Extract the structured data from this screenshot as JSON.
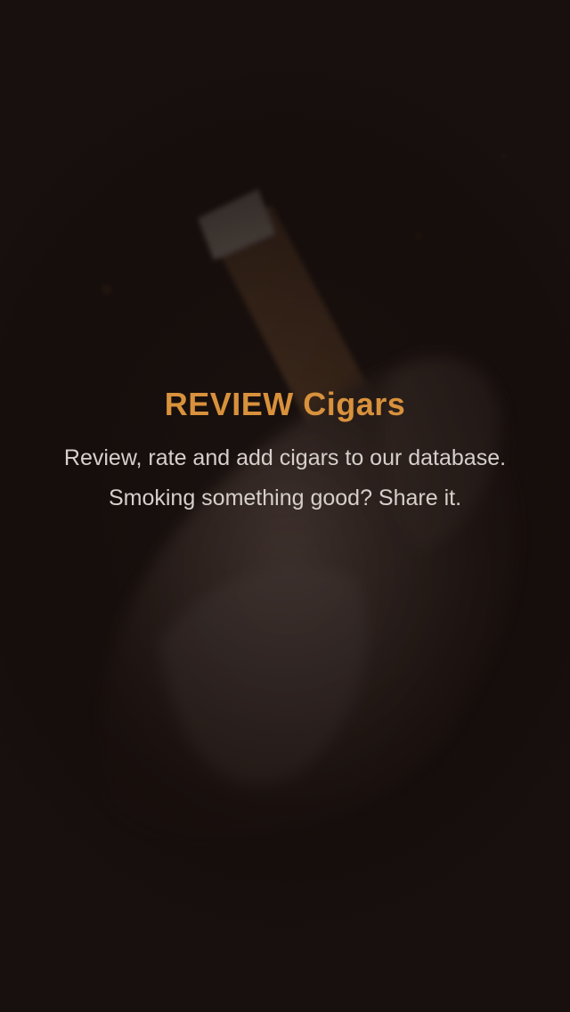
{
  "onboarding": {
    "title": "REVIEW Cigars",
    "description": "Review, rate and add cigars to our database. Smoking something good? Share it.",
    "background_image": "hand-holding-cigar-photo"
  },
  "colors": {
    "background": "#1a1210",
    "title": "#d8913c",
    "body_text": "#d6cfcb"
  }
}
